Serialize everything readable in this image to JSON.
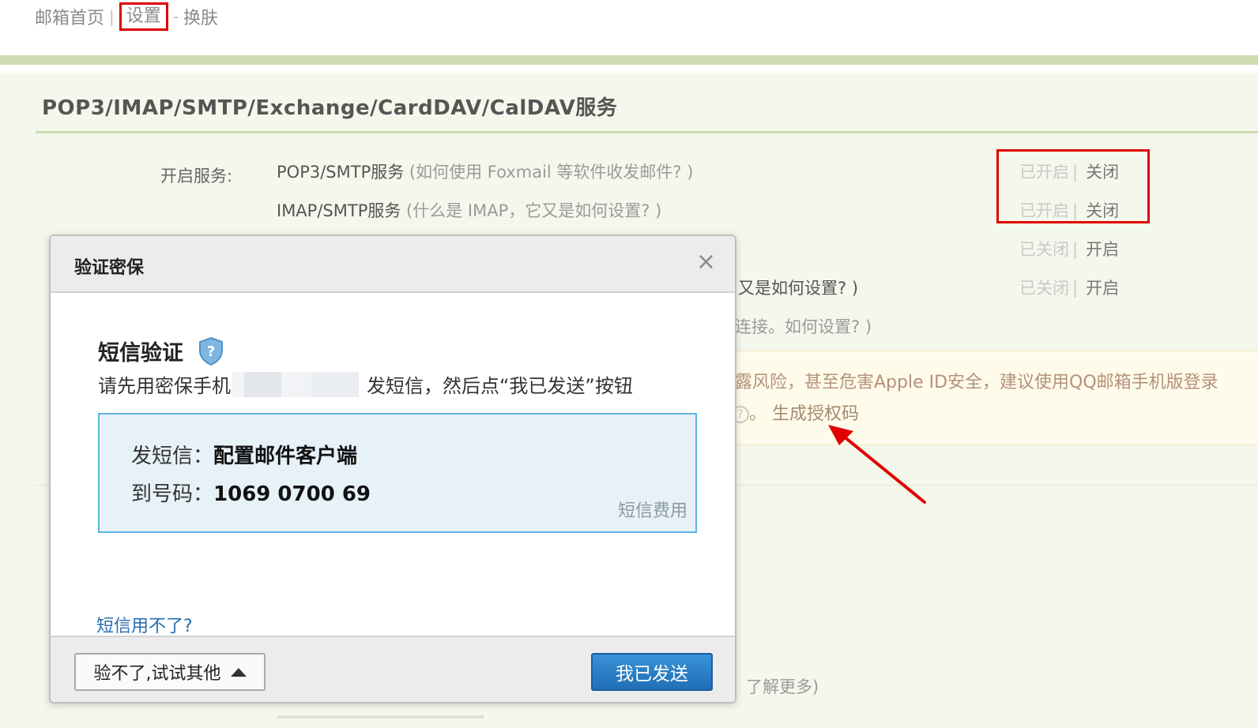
{
  "nav": {
    "home": "邮箱首页",
    "settings": "设置",
    "skin": "换肤",
    "sep1": "|",
    "sep2": "-"
  },
  "section": {
    "title": "POP3/IMAP/SMTP/Exchange/CardDAV/CalDAV服务"
  },
  "services": {
    "label": "开启服务:",
    "rows": [
      {
        "name": "POP3/SMTP服务",
        "help": "(如何使用 Foxmail 等软件收发邮件? )",
        "status": "已开启",
        "action": "关闭"
      },
      {
        "name": "IMAP/SMTP服务",
        "help": "(什么是 IMAP，它又是如何设置? )",
        "status": "已开启",
        "action": "关闭"
      },
      {
        "name": "",
        "help": "",
        "status": "已关闭",
        "action": "开启"
      },
      {
        "name": "",
        "help": "又是如何设置? )",
        "status": "已关闭",
        "action": "开启"
      },
      {
        "name": "",
        "help": "连接。如何设置? )",
        "status": "",
        "action": ""
      }
    ],
    "status_sep": "|"
  },
  "warning": {
    "text": "露风险，甚至危害Apple ID安全，建议使用QQ邮箱手机版登录",
    "q_glyph": "?",
    "tail": "。",
    "generate_code": "生成授权码"
  },
  "learn_more": "了解更多)",
  "dialog": {
    "title": "验证密保",
    "close_glyph": "×",
    "sms_heading": "短信验证",
    "shield_glyph": "?",
    "instruction_prefix": "请先用密保手机",
    "instruction_suffix": "发短信，然后点“我已发送”按钮",
    "send_label": "发短信：",
    "send_content": "配置邮件客户端",
    "to_label": "到号码：",
    "to_number": "1069 0700 69",
    "fee_link": "短信费用",
    "sms_unavailable": "短信用不了?",
    "other_button": "验不了,试试其他",
    "sent_button": "我已发送"
  },
  "colors": {
    "highlight_red": "#e00000",
    "green_bar": "#cfdcb1",
    "primary_blue": "#1f6fb6",
    "sms_box_border": "#5db3e4"
  }
}
